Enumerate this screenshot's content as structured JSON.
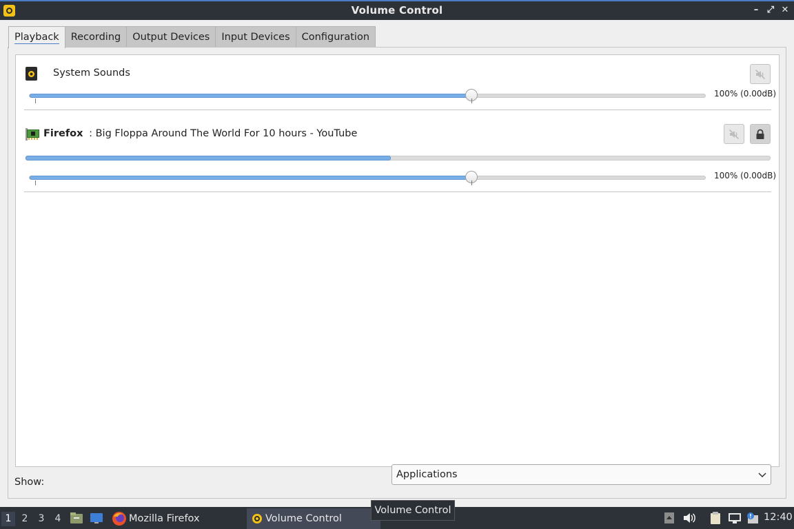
{
  "window": {
    "title": "Volume Control",
    "icon": "volume-control-app-icon",
    "controls": {
      "minimize": "–",
      "maximize": "⤢",
      "close": "✕"
    }
  },
  "tabs": [
    {
      "label": "Playback",
      "active": true
    },
    {
      "label": "Recording",
      "active": false
    },
    {
      "label": "Output Devices",
      "active": false
    },
    {
      "label": "Input Devices",
      "active": false
    },
    {
      "label": "Configuration",
      "active": false
    }
  ],
  "streams": [
    {
      "icon": "speaker-icon",
      "app": "",
      "name": "System Sounds",
      "volume_percent": 100,
      "volume_label": "100% (0.00dB)",
      "muted": false,
      "has_lock": false
    },
    {
      "icon": "sound-card-icon",
      "app": "Firefox",
      "name": ": Big Floppa Around The World For 10 hours - YouTube",
      "volume_percent": 100,
      "volume_label": "100% (0.00dB)",
      "level_fraction": 0.49,
      "muted": false,
      "has_lock": true,
      "locked": true
    }
  ],
  "footer": {
    "show_label": "Show:",
    "show_value": "Applications"
  },
  "taskbar": {
    "workspaces": [
      "1",
      "2",
      "3",
      "4"
    ],
    "active_workspace": "1",
    "launchers": [
      "file-manager-icon",
      "desktop-icon"
    ],
    "tasks": [
      {
        "icon": "firefox-icon",
        "label": "Mozilla Firefox",
        "active": false
      },
      {
        "icon": "volume-control-icon",
        "label": "Volume Control",
        "active": true
      }
    ],
    "tray": [
      "tray-up-arrow-icon",
      "volume-icon",
      "clipboard-icon",
      "network-icon",
      "notification-icon"
    ],
    "clock": "12:40"
  },
  "tooltip": "Volume Control",
  "colors": {
    "accent": "#4a7fc8",
    "slider_fill": "#7aaee6",
    "titlebar_bg": "#2d3138",
    "app_icon_yellow": "#f3c218"
  }
}
